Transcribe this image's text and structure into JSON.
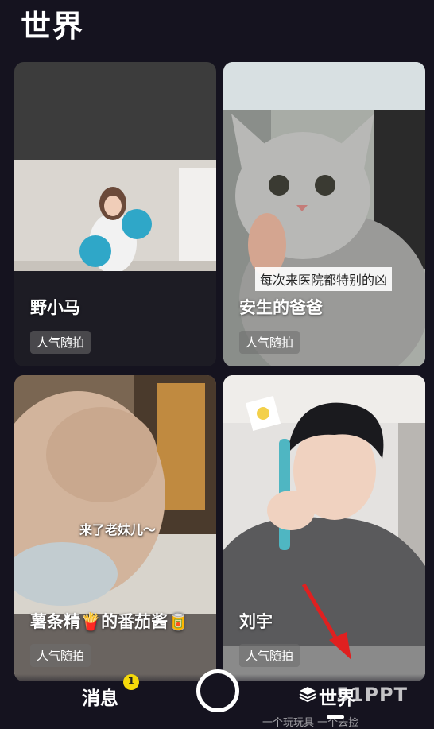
{
  "header": {
    "title": "世界"
  },
  "cards": [
    {
      "name": "野小马",
      "tag": "人气随拍"
    },
    {
      "name": "安生的爸爸",
      "tag": "人气随拍",
      "caption": "每次来医院都特别的凶"
    },
    {
      "name": "薯条精🍟的番茄酱🥫",
      "tag": "人气随拍",
      "caption": "来了老妹儿～"
    },
    {
      "name": "刘宇",
      "tag": "人气随拍"
    }
  ],
  "bottom_nav": {
    "messages_label": "消息",
    "messages_badge": "1",
    "world_label": "世界",
    "watermark": "51PPT",
    "peek_text": "一个玩玩具 一个去捡"
  },
  "colors": {
    "background": "#15131f",
    "badge": "#f5d90a",
    "arrow": "#e02020"
  }
}
